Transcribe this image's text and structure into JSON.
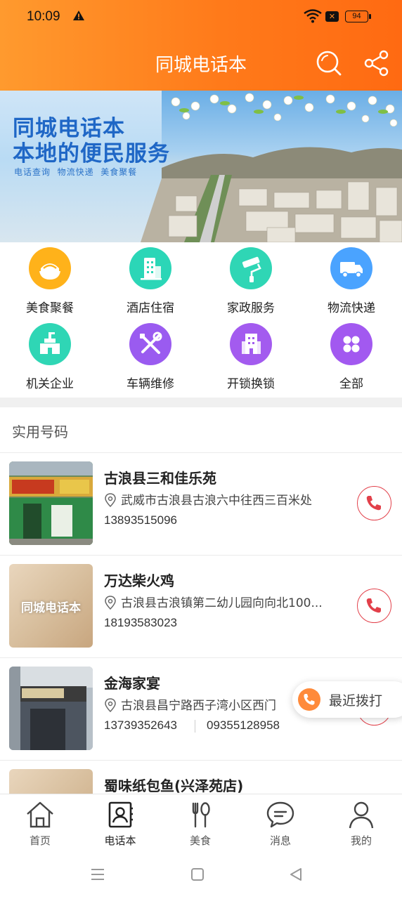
{
  "status_bar": {
    "time": "10:09",
    "battery": "94",
    "icons": [
      "warning-icon",
      "wifi-icon",
      "sim-off-icon",
      "battery-icon"
    ]
  },
  "header": {
    "title": "同城电话本",
    "icons": [
      "search-icon",
      "share-icon"
    ]
  },
  "banner": {
    "headline_1": "同城电话本",
    "headline_2": "本地的便民服务",
    "tagline": "电话查询  物流快递  美食聚餐"
  },
  "categories": [
    {
      "label": "美食聚餐",
      "icon": "food-bowl-icon",
      "color": "#ffb21a"
    },
    {
      "label": "酒店住宿",
      "icon": "hotel-building-icon",
      "color": "#2bd6b7"
    },
    {
      "label": "家政服务",
      "icon": "paint-roller-icon",
      "color": "#2fd6b5"
    },
    {
      "label": "物流快递",
      "icon": "truck-icon",
      "color": "#4aa3ff"
    },
    {
      "label": "机关企业",
      "icon": "government-building-icon",
      "color": "#2fd6b5"
    },
    {
      "label": "车辆维修",
      "icon": "tools-icon",
      "color": "#9a5bf0"
    },
    {
      "label": "开锁换锁",
      "icon": "office-building-icon",
      "color": "#a35bef"
    },
    {
      "label": "全部",
      "icon": "grid-all-icon",
      "color": "#a259f0"
    }
  ],
  "section_title": "实用号码",
  "listings": [
    {
      "name": "古浪县三和佳乐苑",
      "address": "武威市古浪县古浪六中往西三百米处",
      "phones": [
        "13893515096"
      ],
      "thumb_text": ""
    },
    {
      "name": "万达柴火鸡",
      "address": "古浪县古浪镇第二幼儿园向向北100...",
      "phones": [
        "18193583023"
      ],
      "thumb_text": "同城电话本"
    },
    {
      "name": "金海家宴",
      "address": "古浪县昌宁路西子湾小区西门",
      "phones": [
        "13739352643",
        "09355128958"
      ],
      "thumb_text": ""
    },
    {
      "name": "蜀味纸包鱼(兴泽苑店)",
      "address": "",
      "phones": [],
      "thumb_text": ""
    }
  ],
  "floating_button": {
    "label": "最近拨打"
  },
  "tabs": [
    {
      "label": "首页",
      "icon": "home-icon"
    },
    {
      "label": "电话本",
      "icon": "phonebook-icon"
    },
    {
      "label": "美食",
      "icon": "fork-spoon-icon"
    },
    {
      "label": "消息",
      "icon": "chat-bubble-icon"
    },
    {
      "label": "我的",
      "icon": "user-icon"
    }
  ],
  "colors": {
    "header_start": "#ff9a2e",
    "header_end": "#ff6a12",
    "call": "#e2404a",
    "banner_text": "#1f67c6"
  }
}
